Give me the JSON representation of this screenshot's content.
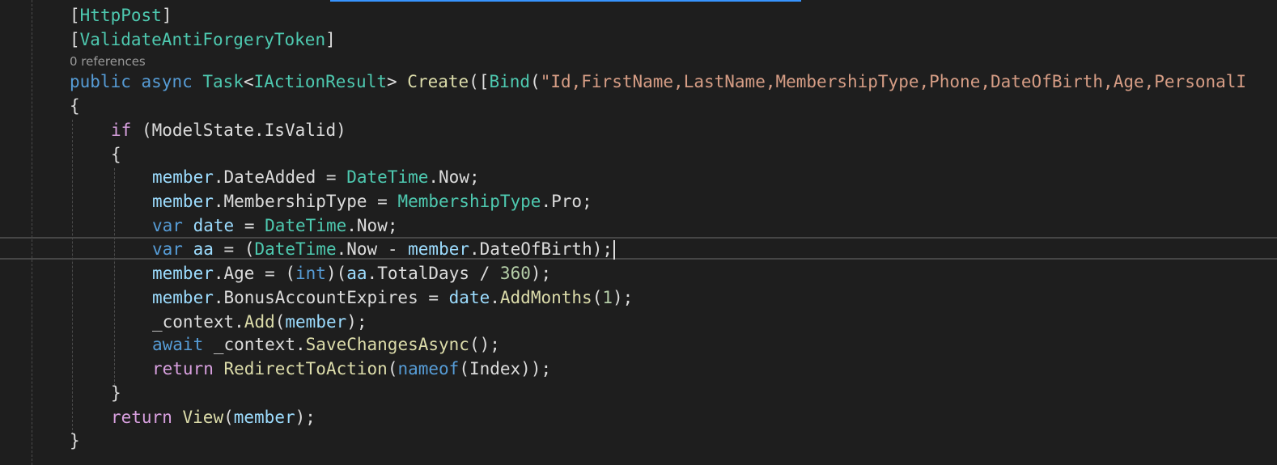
{
  "editor": {
    "codelens": "0 references",
    "lines": [
      {
        "tokens": [
          {
            "c": "p",
            "t": "["
          },
          {
            "c": "t",
            "t": "HttpPost"
          },
          {
            "c": "p",
            "t": "]"
          }
        ]
      },
      {
        "tokens": [
          {
            "c": "p",
            "t": "["
          },
          {
            "c": "t",
            "t": "ValidateAntiForgeryToken"
          },
          {
            "c": "p",
            "t": "]"
          }
        ]
      },
      {
        "tokens": [
          {
            "c": "k",
            "t": "public"
          },
          {
            "c": "p",
            "t": " "
          },
          {
            "c": "k",
            "t": "async"
          },
          {
            "c": "p",
            "t": " "
          },
          {
            "c": "t",
            "t": "Task"
          },
          {
            "c": "p",
            "t": "<"
          },
          {
            "c": "t",
            "t": "IActionResult"
          },
          {
            "c": "p",
            "t": "> "
          },
          {
            "c": "m",
            "t": "Create"
          },
          {
            "c": "p",
            "t": "(["
          },
          {
            "c": "t",
            "t": "Bind"
          },
          {
            "c": "p",
            "t": "("
          },
          {
            "c": "s",
            "t": "\"Id,FirstName,LastName,MembershipType,Phone,DateOfBirth,Age,PersonalI"
          }
        ]
      },
      {
        "tokens": [
          {
            "c": "p",
            "t": "{"
          }
        ]
      },
      {
        "tokens": [
          {
            "c": "kc",
            "t": "if"
          },
          {
            "c": "p",
            "t": " (ModelState.IsValid)"
          }
        ]
      },
      {
        "tokens": [
          {
            "c": "p",
            "t": "{"
          }
        ]
      },
      {
        "tokens": [
          {
            "c": "v",
            "t": "member"
          },
          {
            "c": "p",
            "t": ".DateAdded = "
          },
          {
            "c": "t",
            "t": "DateTime"
          },
          {
            "c": "p",
            "t": ".Now;"
          }
        ]
      },
      {
        "tokens": [
          {
            "c": "v",
            "t": "member"
          },
          {
            "c": "p",
            "t": ".MembershipType = "
          },
          {
            "c": "t",
            "t": "MembershipType"
          },
          {
            "c": "p",
            "t": ".Pro;"
          }
        ]
      },
      {
        "tokens": [
          {
            "c": "k",
            "t": "var"
          },
          {
            "c": "p",
            "t": " "
          },
          {
            "c": "v",
            "t": "date"
          },
          {
            "c": "p",
            "t": " = "
          },
          {
            "c": "t",
            "t": "DateTime"
          },
          {
            "c": "p",
            "t": ".Now;"
          }
        ]
      },
      {
        "tokens": [
          {
            "c": "k",
            "t": "var"
          },
          {
            "c": "p",
            "t": " "
          },
          {
            "c": "v",
            "t": "aa"
          },
          {
            "c": "p",
            "t": " = ("
          },
          {
            "c": "t",
            "t": "DateTime"
          },
          {
            "c": "p",
            "t": ".Now - "
          },
          {
            "c": "v",
            "t": "member"
          },
          {
            "c": "p",
            "t": ".DateOfBirth);"
          }
        ],
        "caret": true
      },
      {
        "tokens": [
          {
            "c": "v",
            "t": "member"
          },
          {
            "c": "p",
            "t": ".Age = ("
          },
          {
            "c": "k",
            "t": "int"
          },
          {
            "c": "p",
            "t": ")("
          },
          {
            "c": "v",
            "t": "aa"
          },
          {
            "c": "p",
            "t": ".TotalDays / "
          },
          {
            "c": "n",
            "t": "360"
          },
          {
            "c": "p",
            "t": ");"
          }
        ]
      },
      {
        "tokens": [
          {
            "c": "v",
            "t": "member"
          },
          {
            "c": "p",
            "t": ".BonusAccountExpires = "
          },
          {
            "c": "v",
            "t": "date"
          },
          {
            "c": "p",
            "t": "."
          },
          {
            "c": "m",
            "t": "AddMonths"
          },
          {
            "c": "p",
            "t": "("
          },
          {
            "c": "n",
            "t": "1"
          },
          {
            "c": "p",
            "t": ");"
          }
        ]
      },
      {
        "tokens": [
          {
            "c": "p",
            "t": "_context."
          },
          {
            "c": "m",
            "t": "Add"
          },
          {
            "c": "p",
            "t": "("
          },
          {
            "c": "v",
            "t": "member"
          },
          {
            "c": "p",
            "t": ");"
          }
        ]
      },
      {
        "tokens": [
          {
            "c": "k",
            "t": "await"
          },
          {
            "c": "p",
            "t": " _context."
          },
          {
            "c": "m",
            "t": "SaveChangesAsync"
          },
          {
            "c": "p",
            "t": "();"
          }
        ]
      },
      {
        "tokens": [
          {
            "c": "kc",
            "t": "return"
          },
          {
            "c": "p",
            "t": " "
          },
          {
            "c": "m",
            "t": "RedirectToAction"
          },
          {
            "c": "p",
            "t": "("
          },
          {
            "c": "k",
            "t": "nameof"
          },
          {
            "c": "p",
            "t": "(Index));"
          }
        ]
      },
      {
        "tokens": [
          {
            "c": "p",
            "t": "}"
          }
        ]
      },
      {
        "tokens": [
          {
            "c": "kc",
            "t": "return"
          },
          {
            "c": "p",
            "t": " "
          },
          {
            "c": "m",
            "t": "View"
          },
          {
            "c": "p",
            "t": "("
          },
          {
            "c": "v",
            "t": "member"
          },
          {
            "c": "p",
            "t": ");"
          }
        ]
      },
      {
        "tokens": [
          {
            "c": "p",
            "t": "}"
          }
        ]
      }
    ]
  },
  "colors": {
    "background": "#1e1e1e",
    "keyword": "#569cd6",
    "control_keyword": "#d8a0df",
    "type": "#4ec9b0",
    "method": "#dcdcaa",
    "variable": "#9cdcfe",
    "string": "#d69d85",
    "number": "#b5cea8",
    "plain": "#dcdcdc"
  }
}
